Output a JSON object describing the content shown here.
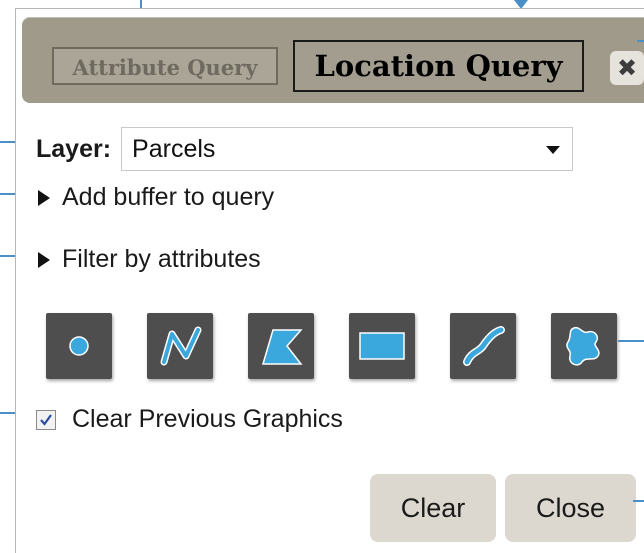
{
  "tabs": {
    "attribute_query": "Attribute Query",
    "location_query": "Location Query"
  },
  "titlebar": {
    "close_glyph": "✖"
  },
  "layer": {
    "label": "Layer:",
    "selected": "Parcels"
  },
  "expanders": {
    "buffer": "Add buffer to query",
    "filter": "Filter by attributes"
  },
  "draw_tools": [
    {
      "icon": "point-draw-icon"
    },
    {
      "icon": "polyline-draw-icon"
    },
    {
      "icon": "polygon-draw-icon"
    },
    {
      "icon": "rectangle-draw-icon"
    },
    {
      "icon": "freehand-line-draw-icon"
    },
    {
      "icon": "freehand-polygon-draw-icon"
    }
  ],
  "clear_graphics": {
    "label": "Clear Previous Graphics",
    "checked": true
  },
  "buttons": {
    "clear": "Clear",
    "close": "Close"
  },
  "colors": {
    "titlebar": "#a09a8b",
    "tool_bg": "#4e4e4e",
    "tool_fill": "#3aa7dd",
    "button_bg": "#dcd8cf",
    "callout": "#4a90c6"
  }
}
